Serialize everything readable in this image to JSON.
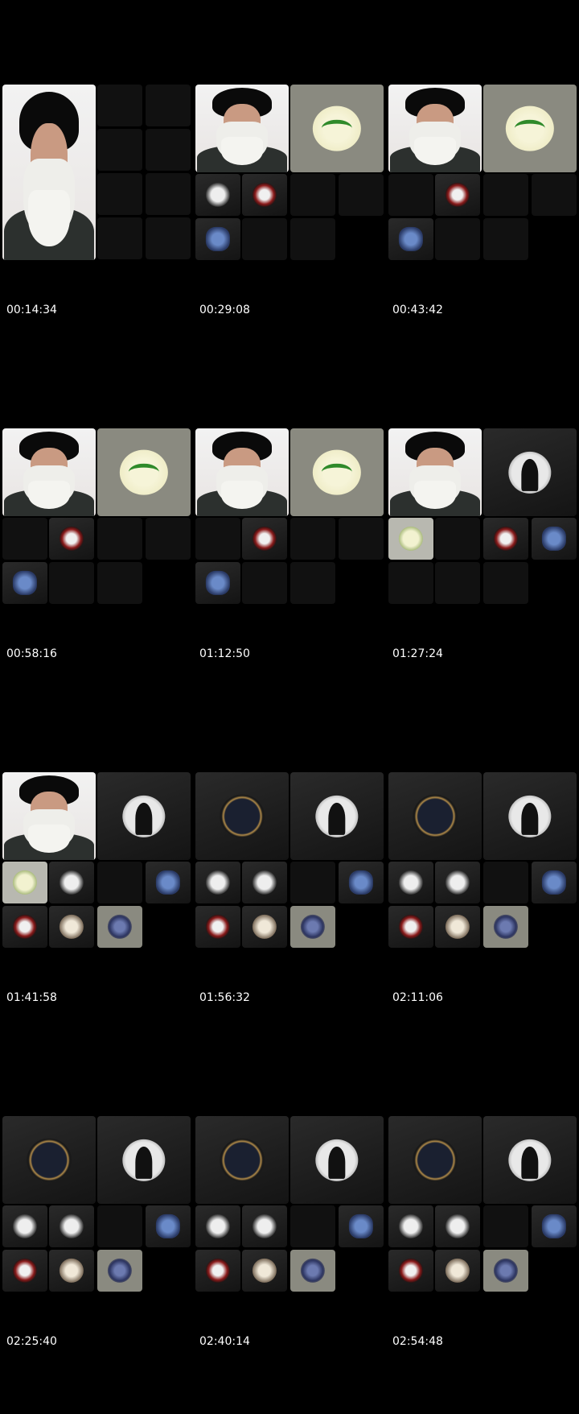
{
  "timestamps": [
    "00:14:34",
    "00:29:08",
    "00:43:42",
    "00:58:16",
    "01:12:50",
    "01:27:24",
    "01:41:58",
    "01:56:32",
    "02:11:06",
    "02:25:40",
    "02:40:14",
    "02:54:48"
  ],
  "icons": {
    "portrait": "portrait-icon",
    "green_emblem": "calligraphy-emblem-icon",
    "gold_emblem": "gold-seal-icon",
    "moon_emblem": "moon-silhouette-icon"
  },
  "colors": {
    "background": "#000000",
    "timestamp_text": "#ffffff"
  }
}
